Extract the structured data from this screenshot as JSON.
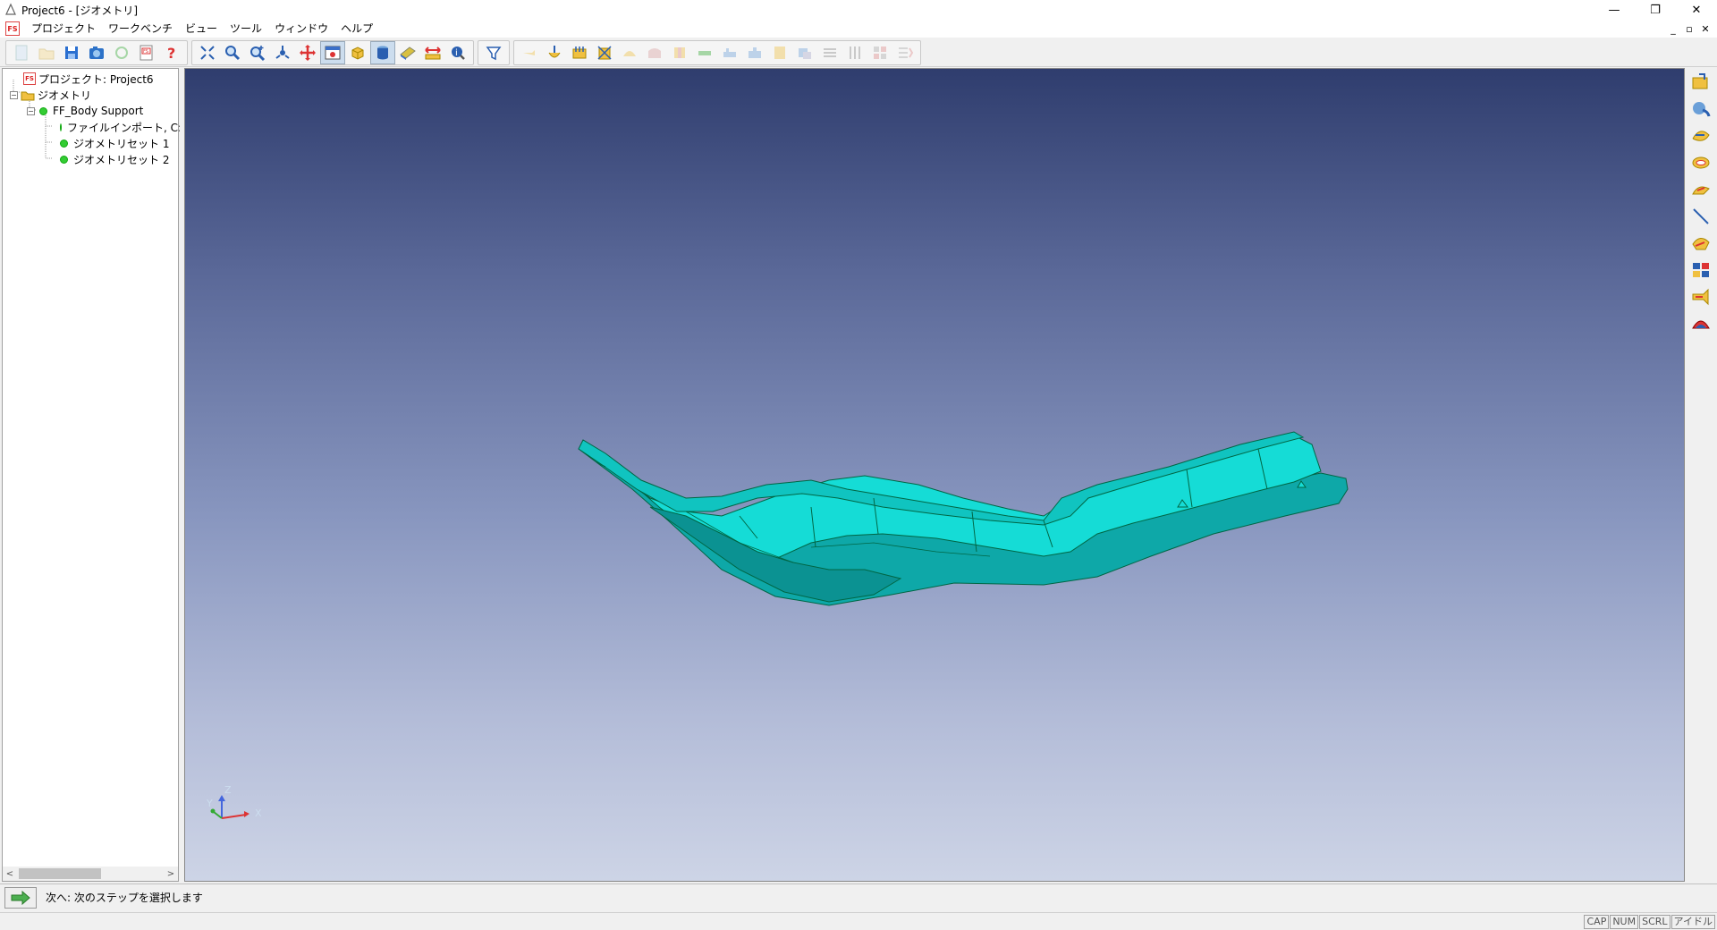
{
  "window": {
    "title": "Project6 - [ジオメトリ]",
    "controls": {
      "minimize": "—",
      "restore": "❐",
      "close": "✕"
    }
  },
  "menubar": {
    "logo": "FS",
    "items": [
      "プロジェクト",
      "ワークベンチ",
      "ビュー",
      "ツール",
      "ウィンドウ",
      "ヘルプ"
    ],
    "mdi_controls": {
      "minimize": "_",
      "restore": "▫",
      "close": "✕"
    }
  },
  "tree": {
    "project": "プロジェクト: Project6",
    "geometry": "ジオメトリ",
    "body": "FF_Body Support",
    "children": [
      "ファイルインポート, C:¥FT",
      "ジオメトリセット 1",
      "ジオメトリセット 2"
    ]
  },
  "axis_triad": {
    "z": "Z",
    "y": "Y",
    "x": "X"
  },
  "message": "次へ: 次のステップを選択します",
  "status": [
    "CAP",
    "NUM",
    "SCRL",
    "アイドル"
  ],
  "colors": {
    "model_fill": "#0fb5b5",
    "model_light": "#16e6e0",
    "viewport_top": "#2f3d6e",
    "viewport_bottom": "#cdd4e6"
  },
  "toolbar_icons": [
    "new-icon",
    "open-icon",
    "save-icon",
    "snapshot-icon",
    "refresh-icon",
    "report-icon",
    "help-icon",
    "fit-icon",
    "zoom-icon",
    "zoom-box-icon",
    "rotate-icon",
    "pan-icon",
    "view-settings-icon",
    "shaded-cube-icon",
    "solid-icon",
    "section-icon",
    "measure-icon",
    "info-icon",
    "filter-icon"
  ]
}
